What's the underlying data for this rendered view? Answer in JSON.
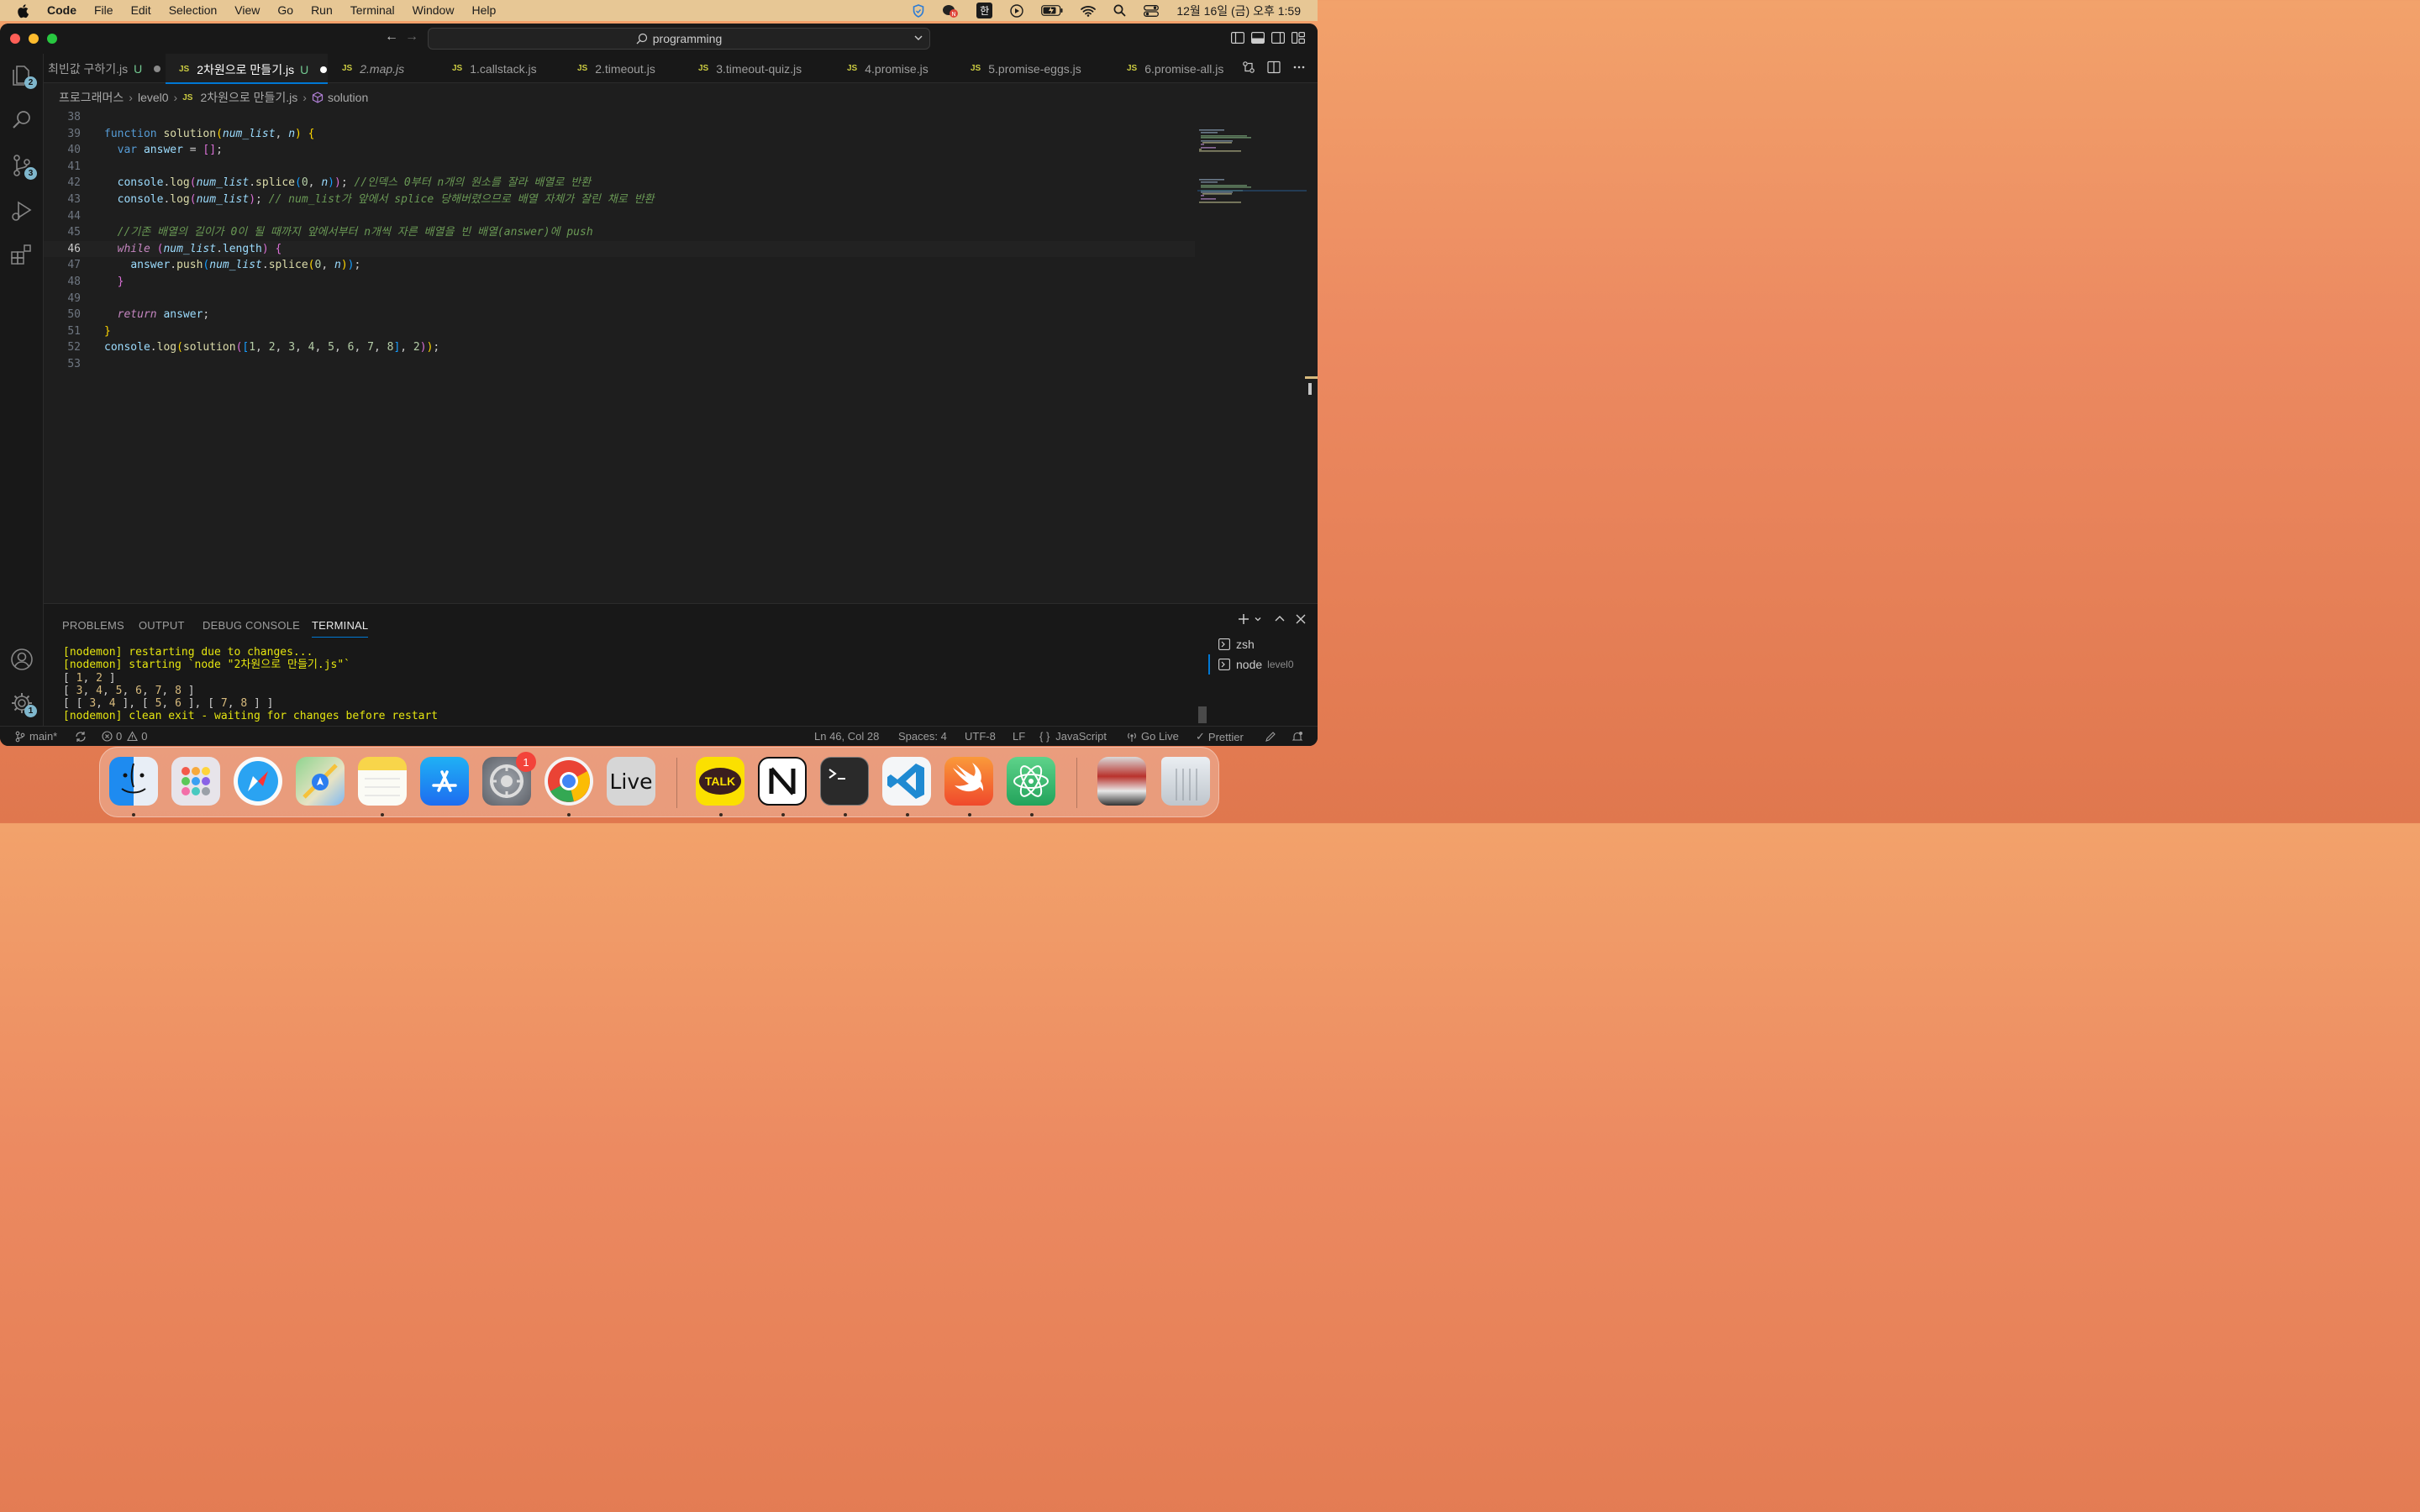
{
  "menubar": {
    "app": "Code",
    "items": [
      "File",
      "Edit",
      "Selection",
      "View",
      "Go",
      "Run",
      "Terminal",
      "Window",
      "Help"
    ],
    "ime": "한",
    "clock": "12월 16일 (금) 오후 1:59"
  },
  "titlebar": {
    "search": "programming"
  },
  "activity": {
    "explorer_badge": "2",
    "scm_badge": "3",
    "settings_badge": "1"
  },
  "tabs": [
    {
      "label": "최빈값 구하기.js",
      "status": "U",
      "modified_dot": true,
      "active": false,
      "italic": false,
      "icon": ""
    },
    {
      "label": "2차원으로 만들기.js",
      "status": "U",
      "modified_dot": true,
      "active": true,
      "italic": false,
      "icon": "JS"
    },
    {
      "label": "2.map.js",
      "status": "",
      "modified_dot": false,
      "active": false,
      "italic": true,
      "icon": "JS"
    },
    {
      "label": "1.callstack.js",
      "status": "",
      "modified_dot": false,
      "active": false,
      "italic": false,
      "icon": "JS"
    },
    {
      "label": "2.timeout.js",
      "status": "",
      "modified_dot": false,
      "active": false,
      "italic": false,
      "icon": "JS"
    },
    {
      "label": "3.timeout-quiz.js",
      "status": "",
      "modified_dot": false,
      "active": false,
      "italic": false,
      "icon": "JS"
    },
    {
      "label": "4.promise.js",
      "status": "",
      "modified_dot": false,
      "active": false,
      "italic": false,
      "icon": "JS"
    },
    {
      "label": "5.promise-eggs.js",
      "status": "",
      "modified_dot": false,
      "active": false,
      "italic": false,
      "icon": "JS"
    },
    {
      "label": "6.promise-all.js",
      "status": "",
      "modified_dot": false,
      "active": false,
      "italic": false,
      "icon": "JS"
    }
  ],
  "breadcrumbs": {
    "folder1": "프로그래머스",
    "folder2": "level0",
    "file_icon": "JS",
    "file": "2차원으로 만들기.js",
    "symbol": "solution"
  },
  "code": {
    "current_line": 46,
    "lines": [
      {
        "n": 38,
        "tokens": []
      },
      {
        "n": 39,
        "tokens": [
          [
            "kw",
            "function "
          ],
          [
            "fn",
            "solution"
          ],
          [
            "br1",
            "("
          ],
          [
            "pa it",
            "num_list"
          ],
          [
            "pu",
            ", "
          ],
          [
            "pa it",
            "n"
          ],
          [
            "br1",
            ")"
          ],
          [
            "pu",
            " "
          ],
          [
            "br1",
            "{"
          ]
        ]
      },
      {
        "n": 40,
        "tokens": [
          [
            "pu",
            "  "
          ],
          [
            "kw",
            "var "
          ],
          [
            "pa",
            "answer"
          ],
          [
            "pu",
            " = "
          ],
          [
            "br2",
            "[]"
          ],
          [
            "pu",
            ";"
          ]
        ]
      },
      {
        "n": 41,
        "tokens": []
      },
      {
        "n": 42,
        "tokens": [
          [
            "pu",
            "  "
          ],
          [
            "pa",
            "console"
          ],
          [
            "pu",
            "."
          ],
          [
            "fn",
            "log"
          ],
          [
            "br2",
            "("
          ],
          [
            "pa it",
            "num_list"
          ],
          [
            "pu",
            "."
          ],
          [
            "fn",
            "splice"
          ],
          [
            "br3",
            "("
          ],
          [
            "num",
            "0"
          ],
          [
            "pu",
            ", "
          ],
          [
            "pa it",
            "n"
          ],
          [
            "br3",
            ")"
          ],
          [
            "br2",
            ")"
          ],
          [
            "pu",
            "; "
          ],
          [
            "cm it",
            "//인덱스 0부터 n개의 원소를 잘라 배열로 반환"
          ]
        ]
      },
      {
        "n": 43,
        "tokens": [
          [
            "pu",
            "  "
          ],
          [
            "pa",
            "console"
          ],
          [
            "pu",
            "."
          ],
          [
            "fn",
            "log"
          ],
          [
            "br2",
            "("
          ],
          [
            "pa it",
            "num_list"
          ],
          [
            "br2",
            ")"
          ],
          [
            "pu",
            "; "
          ],
          [
            "cm it",
            "// num_list가 앞에서 splice 당해버렸으므로 배열 자체가 잘린 채로 반환"
          ]
        ]
      },
      {
        "n": 44,
        "tokens": []
      },
      {
        "n": 45,
        "tokens": [
          [
            "pu",
            "  "
          ],
          [
            "cm it",
            "//기존 배열의 길이가 0이 될 때까지 앞에서부터 n개씩 자른 배열을 빈 배열(answer)에 push"
          ]
        ]
      },
      {
        "n": 46,
        "tokens": [
          [
            "pu",
            "  "
          ],
          [
            "k2 it",
            "while"
          ],
          [
            "pu",
            " "
          ],
          [
            "br2",
            "("
          ],
          [
            "pa it",
            "num_list"
          ],
          [
            "pu",
            "."
          ],
          [
            "pa",
            "length"
          ],
          [
            "br2",
            ")"
          ],
          [
            "pu",
            " "
          ],
          [
            "br2",
            "{"
          ]
        ]
      },
      {
        "n": 47,
        "tokens": [
          [
            "pu",
            "    "
          ],
          [
            "pa",
            "answer"
          ],
          [
            "pu",
            "."
          ],
          [
            "fn",
            "push"
          ],
          [
            "br3",
            "("
          ],
          [
            "pa it",
            "num_list"
          ],
          [
            "pu",
            "."
          ],
          [
            "fn",
            "splice"
          ],
          [
            "br1",
            "("
          ],
          [
            "num",
            "0"
          ],
          [
            "pu",
            ", "
          ],
          [
            "pa it",
            "n"
          ],
          [
            "br1",
            ")"
          ],
          [
            "br3",
            ")"
          ],
          [
            "pu",
            ";"
          ]
        ]
      },
      {
        "n": 48,
        "tokens": [
          [
            "pu",
            "  "
          ],
          [
            "br2",
            "}"
          ]
        ]
      },
      {
        "n": 49,
        "tokens": []
      },
      {
        "n": 50,
        "tokens": [
          [
            "pu",
            "  "
          ],
          [
            "k2 it",
            "return "
          ],
          [
            "pa",
            "answer"
          ],
          [
            "pu",
            ";"
          ]
        ]
      },
      {
        "n": 51,
        "tokens": [
          [
            "br1",
            "}"
          ]
        ]
      },
      {
        "n": 52,
        "tokens": [
          [
            "pa",
            "console"
          ],
          [
            "pu",
            "."
          ],
          [
            "fn",
            "log"
          ],
          [
            "br1",
            "("
          ],
          [
            "fn",
            "solution"
          ],
          [
            "br2",
            "("
          ],
          [
            "br3",
            "["
          ],
          [
            "num",
            "1"
          ],
          [
            "pu",
            ", "
          ],
          [
            "num",
            "2"
          ],
          [
            "pu",
            ", "
          ],
          [
            "num",
            "3"
          ],
          [
            "pu",
            ", "
          ],
          [
            "num",
            "4"
          ],
          [
            "pu",
            ", "
          ],
          [
            "num",
            "5"
          ],
          [
            "pu",
            ", "
          ],
          [
            "num",
            "6"
          ],
          [
            "pu",
            ", "
          ],
          [
            "num",
            "7"
          ],
          [
            "pu",
            ", "
          ],
          [
            "num",
            "8"
          ],
          [
            "br3",
            "]"
          ],
          [
            "pu",
            ", "
          ],
          [
            "num",
            "2"
          ],
          [
            "br2",
            ")"
          ],
          [
            "br1",
            ")"
          ],
          [
            "pu",
            ";"
          ]
        ]
      },
      {
        "n": 53,
        "tokens": []
      }
    ]
  },
  "panel": {
    "tabs": [
      "PROBLEMS",
      "OUTPUT",
      "DEBUG CONSOLE",
      "TERMINAL"
    ],
    "active": "TERMINAL",
    "terminal_lines": [
      [
        [
          "tyellow",
          "[nodemon] restarting due to changes..."
        ]
      ],
      [
        [
          "tyellow",
          "[nodemon] starting `node \"2차원으로 만들기.js\"`"
        ]
      ],
      [
        [
          "twhite",
          "[ "
        ],
        [
          "tnum",
          "1"
        ],
        [
          "twhite",
          ", "
        ],
        [
          "tnum",
          "2"
        ],
        [
          "twhite",
          " ]"
        ]
      ],
      [
        [
          "twhite",
          "[ "
        ],
        [
          "tnum",
          "3"
        ],
        [
          "twhite",
          ", "
        ],
        [
          "tnum",
          "4"
        ],
        [
          "twhite",
          ", "
        ],
        [
          "tnum",
          "5"
        ],
        [
          "twhite",
          ", "
        ],
        [
          "tnum",
          "6"
        ],
        [
          "twhite",
          ", "
        ],
        [
          "tnum",
          "7"
        ],
        [
          "twhite",
          ", "
        ],
        [
          "tnum",
          "8"
        ],
        [
          "twhite",
          " ]"
        ]
      ],
      [
        [
          "twhite",
          "[ [ "
        ],
        [
          "tnum",
          "3"
        ],
        [
          "twhite",
          ", "
        ],
        [
          "tnum",
          "4"
        ],
        [
          "twhite",
          " ], [ "
        ],
        [
          "tnum",
          "5"
        ],
        [
          "twhite",
          ", "
        ],
        [
          "tnum",
          "6"
        ],
        [
          "twhite",
          " ], [ "
        ],
        [
          "tnum",
          "7"
        ],
        [
          "twhite",
          ", "
        ],
        [
          "tnum",
          "8"
        ],
        [
          "twhite",
          " ] ]"
        ]
      ],
      [
        [
          "tyellow",
          "[nodemon] clean exit - waiting for changes before restart"
        ]
      ]
    ],
    "shells": [
      {
        "name": "zsh",
        "sub": ""
      },
      {
        "name": "node",
        "sub": "level0"
      }
    ]
  },
  "status": {
    "branch": "main*",
    "errors": "0",
    "warnings": "0",
    "position": "Ln 46, Col 28",
    "spaces": "Spaces: 4",
    "encoding": "UTF-8",
    "eol": "LF",
    "language": "JavaScript",
    "golive": "Go Live",
    "prettier": "Prettier"
  },
  "dock": {
    "settings_badge": "1",
    "apps": [
      "finder",
      "launchpad",
      "safari",
      "maps",
      "notes",
      "app-store",
      "system-settings",
      "chrome",
      "live",
      "kakaotalk",
      "notion",
      "terminal",
      "vscode",
      "swift",
      "atom",
      "photo-thumbnail",
      "trash"
    ],
    "live_label": "Live",
    "talk_label": "TALK"
  }
}
